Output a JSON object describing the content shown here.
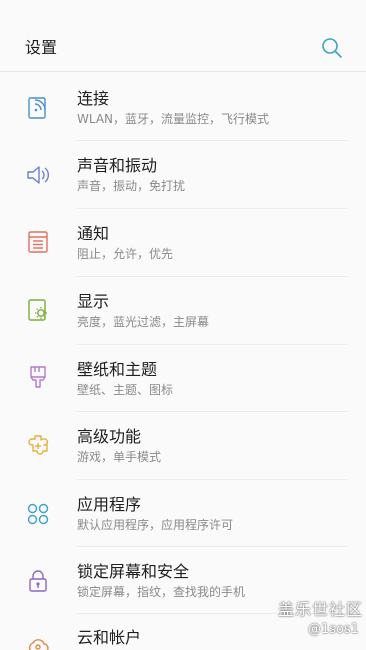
{
  "header": {
    "title": "设置",
    "search_icon": "search-icon"
  },
  "items": [
    {
      "title": "连接",
      "subtitle": "WLAN，蓝牙，流量监控，飞行模式",
      "icon": "connections-icon",
      "color": "#4a90c8"
    },
    {
      "title": "声音和振动",
      "subtitle": "声音，振动，免打扰",
      "icon": "speaker-icon",
      "color": "#6a7fd1"
    },
    {
      "title": "通知",
      "subtitle": "阻止，允许，优先",
      "icon": "notification-icon",
      "color": "#e0705e"
    },
    {
      "title": "显示",
      "subtitle": "亮度，蓝光过滤，主屏幕",
      "icon": "display-icon",
      "color": "#7bae3a"
    },
    {
      "title": "壁纸和主题",
      "subtitle": "壁纸、主题、图标",
      "icon": "brush-icon",
      "color": "#b37ad0"
    },
    {
      "title": "高级功能",
      "subtitle": "游戏，单手模式",
      "icon": "advanced-features-icon",
      "color": "#e2b23e"
    },
    {
      "title": "应用程序",
      "subtitle": "默认应用程序，应用程序许可",
      "icon": "apps-icon",
      "color": "#3aa3c7"
    },
    {
      "title": "锁定屏幕和安全",
      "subtitle": "锁定屏幕，指纹，查找我的手机",
      "icon": "lock-icon",
      "color": "#8a69c2"
    },
    {
      "title": "云和帐户",
      "subtitle": "",
      "icon": "cloud-account-icon",
      "color": "#e08a4e"
    }
  ],
  "watermark": {
    "line1": "盖乐世社区",
    "line2": "@1sos1"
  }
}
